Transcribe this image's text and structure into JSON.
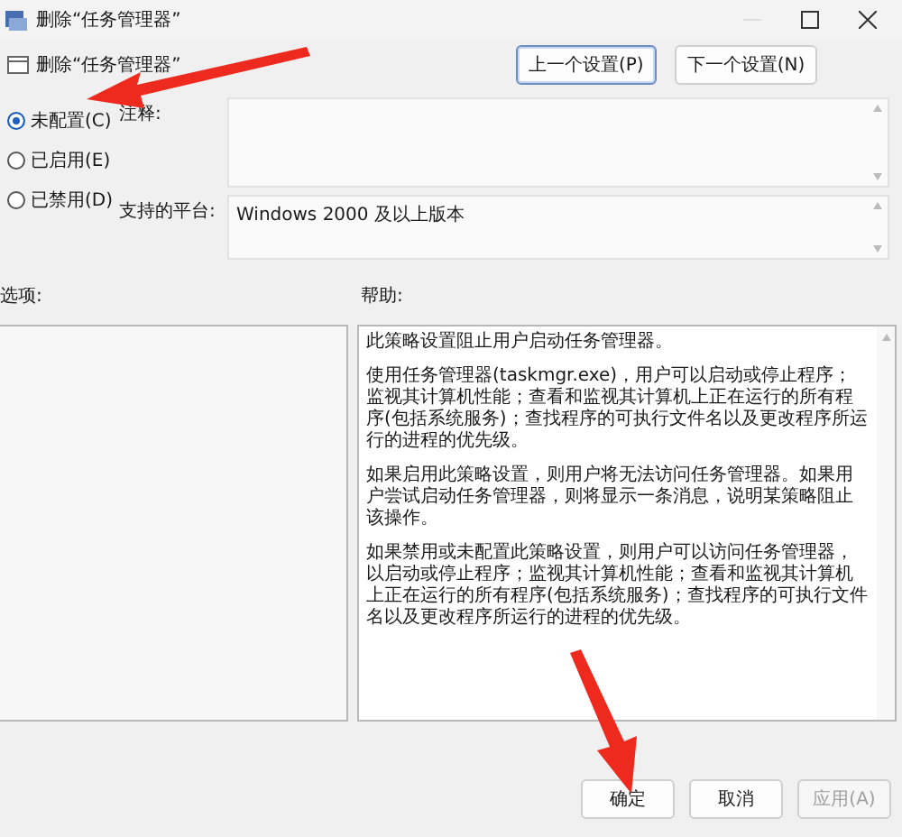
{
  "window": {
    "title": "删除“任务管理器”"
  },
  "policy_title": "删除“任务管理器”",
  "nav_buttons": [
    {
      "label": "上一个设置(P)",
      "focused": true
    },
    {
      "label": "下一个设置(N)",
      "focused": false
    }
  ],
  "options": [
    {
      "label": "未配置(C)",
      "selected": true
    },
    {
      "label": "已启用(E)",
      "selected": false
    },
    {
      "label": "已禁用(D)",
      "selected": false
    }
  ],
  "comment": {
    "label": "注释:"
  },
  "platform": {
    "label": "支持的平台:",
    "value": "Windows 2000 及以上版本"
  },
  "options_label": "选项:",
  "help": {
    "label": "帮助:",
    "paragraphs": [
      "此策略设置阻止用户启动任务管理器。",
      "使用任务管理器(taskmgr.exe)，用户可以启动或停止程序；监视其计算机性能；查看和监视其计算机上正在运行的所有程序(包括系统服务)；查找程序的可执行文件名以及更改程序所运行的进程的优先级。",
      "如果启用此策略设置，则用户将无法访问任务管理器。如果用户尝试启动任务管理器，则将显示一条消息，说明某策略阻止该操作。",
      "如果禁用或未配置此策略设置，则用户可以访问任务管理器，以启动或停止程序；监视其计算机性能；查看和监视其计算机上正在运行的所有程序(包括系统服务)；查找程序的可执行文件名以及更改程序所运行的进程的优先级。"
    ]
  },
  "buttons": [
    {
      "label": "确定",
      "disabled": false
    },
    {
      "label": "取消",
      "disabled": false
    },
    {
      "label": "应用(A)",
      "disabled": true
    }
  ]
}
